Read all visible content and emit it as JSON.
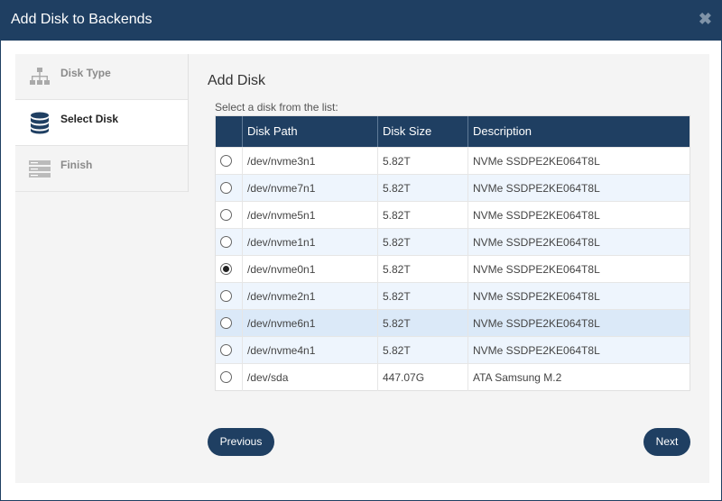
{
  "dialog": {
    "title": "Add Disk to Backends",
    "close_glyph": "✖"
  },
  "sidebar": {
    "steps": [
      {
        "label": "Disk Type",
        "icon": "sitemap-icon",
        "active": false
      },
      {
        "label": "Select Disk",
        "icon": "database-icon",
        "active": true
      },
      {
        "label": "Finish",
        "icon": "server-icon",
        "active": false
      }
    ]
  },
  "main": {
    "title": "Add Disk",
    "hint": "Select a disk from the list:",
    "columns": [
      "Disk Path",
      "Disk Size",
      "Description"
    ],
    "rows": [
      {
        "path": "/dev/nvme3n1",
        "size": "5.82T",
        "desc": "NVMe SSDPE2KE064T8L",
        "selected": false
      },
      {
        "path": "/dev/nvme7n1",
        "size": "5.82T",
        "desc": "NVMe SSDPE2KE064T8L",
        "selected": false
      },
      {
        "path": "/dev/nvme5n1",
        "size": "5.82T",
        "desc": "NVMe SSDPE2KE064T8L",
        "selected": false
      },
      {
        "path": "/dev/nvme1n1",
        "size": "5.82T",
        "desc": "NVMe SSDPE2KE064T8L",
        "selected": false
      },
      {
        "path": "/dev/nvme0n1",
        "size": "5.82T",
        "desc": "NVMe SSDPE2KE064T8L",
        "selected": true
      },
      {
        "path": "/dev/nvme2n1",
        "size": "5.82T",
        "desc": "NVMe SSDPE2KE064T8L",
        "selected": false
      },
      {
        "path": "/dev/nvme6n1",
        "size": "5.82T",
        "desc": "NVMe SSDPE2KE064T8L",
        "selected": false
      },
      {
        "path": "/dev/nvme4n1",
        "size": "5.82T",
        "desc": "NVMe SSDPE2KE064T8L",
        "selected": false
      },
      {
        "path": "/dev/sda",
        "size": "447.07G",
        "desc": "ATA Samsung M.2",
        "selected": false
      }
    ],
    "previous_label": "Previous",
    "next_label": "Next"
  },
  "colors": {
    "brand_navy": "#1f3f62",
    "row_alt": "#eef5fd",
    "row_hover": "#dbe9f8"
  }
}
